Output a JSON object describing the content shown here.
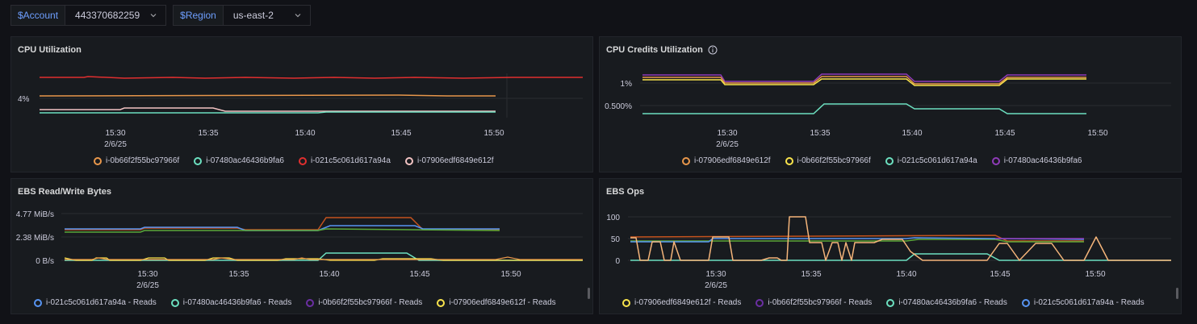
{
  "variables": [
    {
      "label": "$Account",
      "value": "443370682259"
    },
    {
      "label": "$Region",
      "value": "us-east-2"
    }
  ],
  "colors": {
    "orange": "#e8974b",
    "teal": "#6ce0c0",
    "red": "#e02f2f",
    "pink": "#f2c3c3",
    "yellow": "#f9e44c",
    "purple": "#8f3bb8",
    "blue": "#5794f2",
    "indigo": "#6b2fa3",
    "darkorange": "#c4531e",
    "green": "#5aa83a"
  },
  "panels": {
    "cpu": {
      "title": "CPU Utilization",
      "legend": [
        "i-0b66f2f55bc97966f",
        "i-07480ac46436b9fa6",
        "i-021c5c061d617a94a",
        "i-07906edf6849e612f"
      ],
      "yticks": [
        "4%"
      ],
      "xticks": [
        "15:30",
        "15:35",
        "15:40",
        "15:45",
        "15:50"
      ],
      "xdate": "2/6/25"
    },
    "credits": {
      "title": "CPU Credits Utilization",
      "legend": [
        "i-07906edf6849e612f",
        "i-0b66f2f55bc97966f",
        "i-021c5c061d617a94a",
        "i-07480ac46436b9fa6"
      ],
      "yticks": [
        "1%",
        "0.500%"
      ],
      "xticks": [
        "15:30",
        "15:35",
        "15:40",
        "15:45",
        "15:50"
      ],
      "xdate": "2/6/25"
    },
    "ebsbytes": {
      "title": "EBS Read/Write Bytes",
      "legend": [
        "i-021c5c061d617a94a - Reads",
        "i-07480ac46436b9fa6 - Reads",
        "i-0b66f2f55bc97966f - Reads",
        "i-07906edf6849e612f - Reads"
      ],
      "yticks": [
        "4.77 MiB/s",
        "2.38 MiB/s",
        "0 B/s"
      ],
      "xticks": [
        "15:30",
        "15:35",
        "15:40",
        "15:45",
        "15:50"
      ],
      "xdate": "2/6/25"
    },
    "ebsops": {
      "title": "EBS Ops",
      "legend": [
        "i-07906edf6849e612f - Reads",
        "i-0b66f2f55bc97966f - Reads",
        "i-07480ac46436b9fa6 - Reads",
        "i-021c5c061d617a94a - Reads"
      ],
      "yticks": [
        "100",
        "50",
        "0"
      ],
      "xticks": [
        "15:30",
        "15:35",
        "15:40",
        "15:45",
        "15:50"
      ],
      "xdate": "2/6/25"
    }
  }
}
